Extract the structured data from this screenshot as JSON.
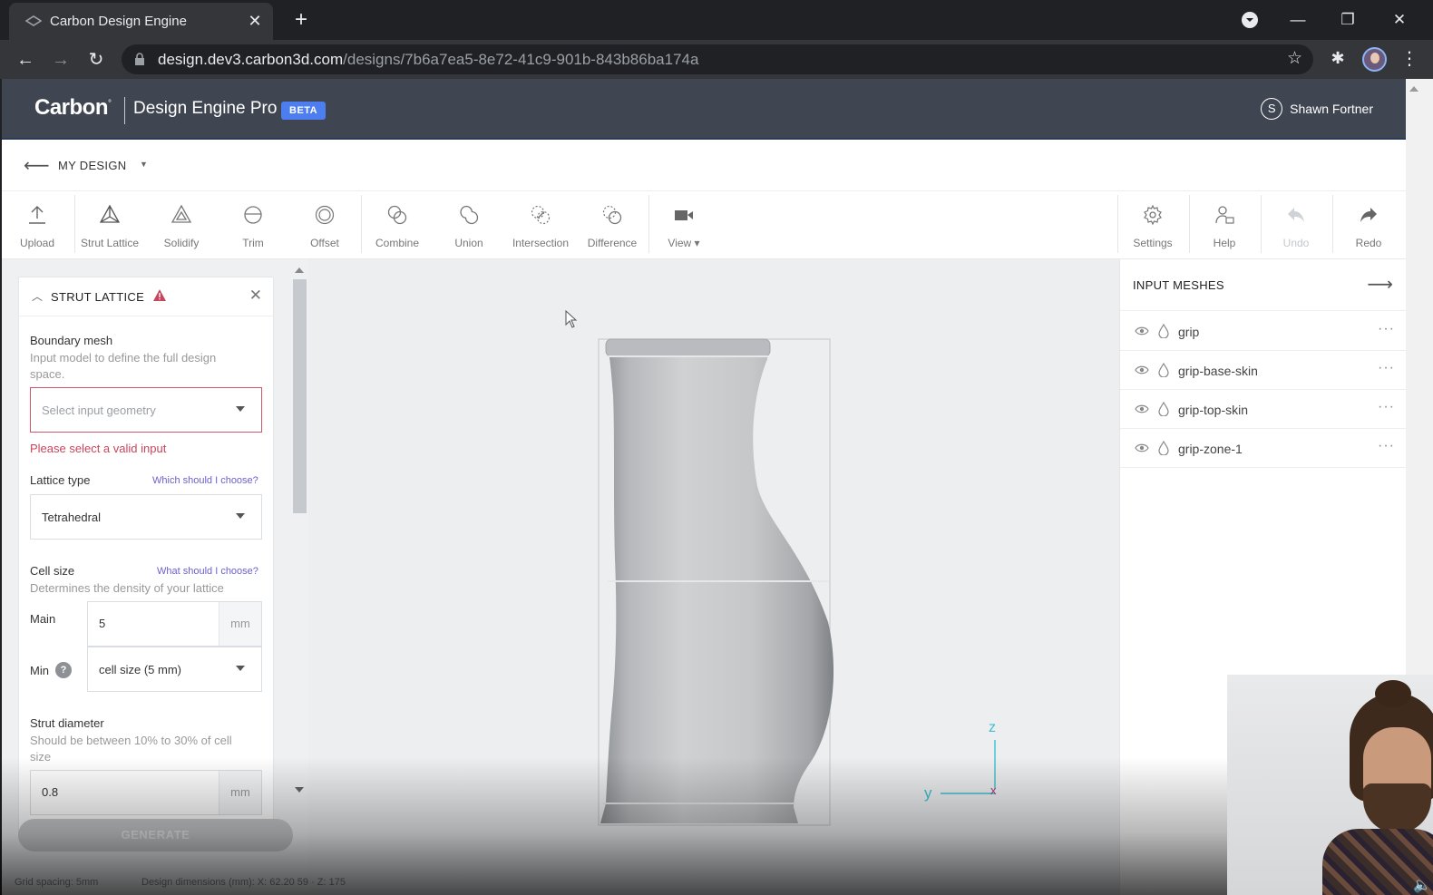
{
  "browser": {
    "tab_title": "Carbon Design Engine",
    "close_glyph": "✕",
    "new_tab_glyph": "+",
    "url_host": "design.dev3.carbon3d.com",
    "url_path": "/designs/7b6a7ea5-8e72-41c9-901b-843b86ba174a",
    "back_glyph": "←",
    "forward_glyph": "→",
    "reload_glyph": "↻",
    "star_glyph": "☆",
    "menu_glyph": "⋮",
    "extensions_glyph": "✱",
    "profile_menu_glyph": "▾",
    "minimize_glyph": "—",
    "restore_glyph": "❐",
    "window_close_glyph": "✕"
  },
  "header": {
    "logo": "Carbon",
    "logo_mark": "°",
    "product": "Design Engine Pro",
    "badge": "BETA",
    "user_initial": "S",
    "user_name": "Shawn Fortner"
  },
  "breadcrumb": {
    "back_glyph": "⟵",
    "design_name": "MY DESIGN",
    "caret": "▼"
  },
  "toolbar": {
    "tools": [
      {
        "label": "Upload",
        "icon": "upload-icon"
      },
      {
        "label": "Strut Lattice",
        "icon": "strut-lattice-icon"
      },
      {
        "label": "Solidify",
        "icon": "solidify-icon"
      },
      {
        "label": "Trim",
        "icon": "trim-icon"
      },
      {
        "label": "Offset",
        "icon": "offset-icon"
      },
      {
        "label": "Combine",
        "icon": "combine-icon"
      },
      {
        "label": "Union",
        "icon": "union-icon"
      },
      {
        "label": "Intersection",
        "icon": "intersection-icon"
      },
      {
        "label": "Difference",
        "icon": "difference-icon"
      },
      {
        "label": "View ▾",
        "icon": "camera-icon"
      },
      {
        "label": "Settings",
        "icon": "gear-icon"
      },
      {
        "label": "Help",
        "icon": "help-person-icon"
      },
      {
        "label": "Undo",
        "icon": "undo-icon"
      },
      {
        "label": "Redo",
        "icon": "redo-icon"
      }
    ]
  },
  "strut_panel": {
    "collapse_glyph": "︿",
    "close_glyph": "✕",
    "title": "STRUT LATTICE",
    "boundary_label": "Boundary mesh",
    "boundary_help_1": "Input model to define the full design",
    "boundary_help_2": "space.",
    "boundary_placeholder": "Select input geometry",
    "boundary_error": "Please select a valid input",
    "lattice_label": "Lattice type",
    "lattice_link": "Which should I choose?",
    "lattice_value": "Tetrahedral",
    "cell_label": "Cell size",
    "cell_link": "What should I choose?",
    "cell_help": "Determines the density of your lattice",
    "main_label": "Main",
    "main_value": "5",
    "main_unit": "mm",
    "min_label": "Min",
    "min_help": "?",
    "min_value": "cell size (5 mm)",
    "strut_label": "Strut diameter",
    "strut_help_1": "Should be between 10% to 30% of cell",
    "strut_help_2": "size",
    "strut_value": "0.8",
    "strut_unit": "mm",
    "generate": "GENERATE"
  },
  "input_meshes": {
    "title": "INPUT MESHES",
    "arrow_glyph": "⟶",
    "more_glyph": "···",
    "items": [
      "grip",
      "grip-base-skin",
      "grip-top-skin",
      "grip-zone-1"
    ]
  },
  "viewport": {
    "axis_z": "z",
    "axis_y": "y",
    "axis_x": "x"
  },
  "status": {
    "grid_spacing": "Grid spacing: 5mm",
    "dimensions": "Design dimensions (mm): X: 62.20 59 · Z: 175"
  },
  "webcam": {
    "speaker_glyph": "🔈"
  },
  "colors": {
    "accent": "#4d7ef0",
    "header_bg": "#404651",
    "error": "#c8455c",
    "link": "#6a5fd1"
  }
}
